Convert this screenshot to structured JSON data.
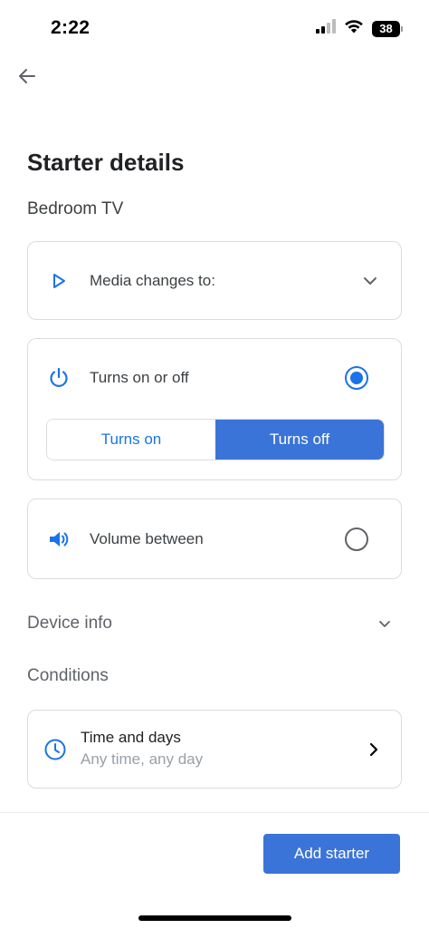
{
  "status_bar": {
    "time": "2:22",
    "battery_level": "38"
  },
  "header": {
    "back_icon": "arrow-back-icon"
  },
  "page": {
    "title": "Starter details",
    "device_name": "Bedroom TV"
  },
  "starters": {
    "media": {
      "icon": "play-icon",
      "label": "Media changes to:"
    },
    "on_off": {
      "icon": "power-icon",
      "label": "Turns on or off",
      "selected": true,
      "options": [
        {
          "label": "Turns on",
          "selected": false
        },
        {
          "label": "Turns off",
          "selected": true
        }
      ]
    },
    "volume": {
      "icon": "volume-icon",
      "label": "Volume between",
      "selected": false
    }
  },
  "sections": {
    "device_info": "Device info",
    "conditions": "Conditions"
  },
  "time_condition": {
    "icon": "clock-icon",
    "title": "Time and days",
    "subtitle": "Any time, any day"
  },
  "footer": {
    "add_button": "Add starter"
  },
  "colors": {
    "accent": "#1a73e8",
    "button": "#3b74d8",
    "text": "#202124",
    "secondary": "#5f6368",
    "border": "#dadce0"
  }
}
